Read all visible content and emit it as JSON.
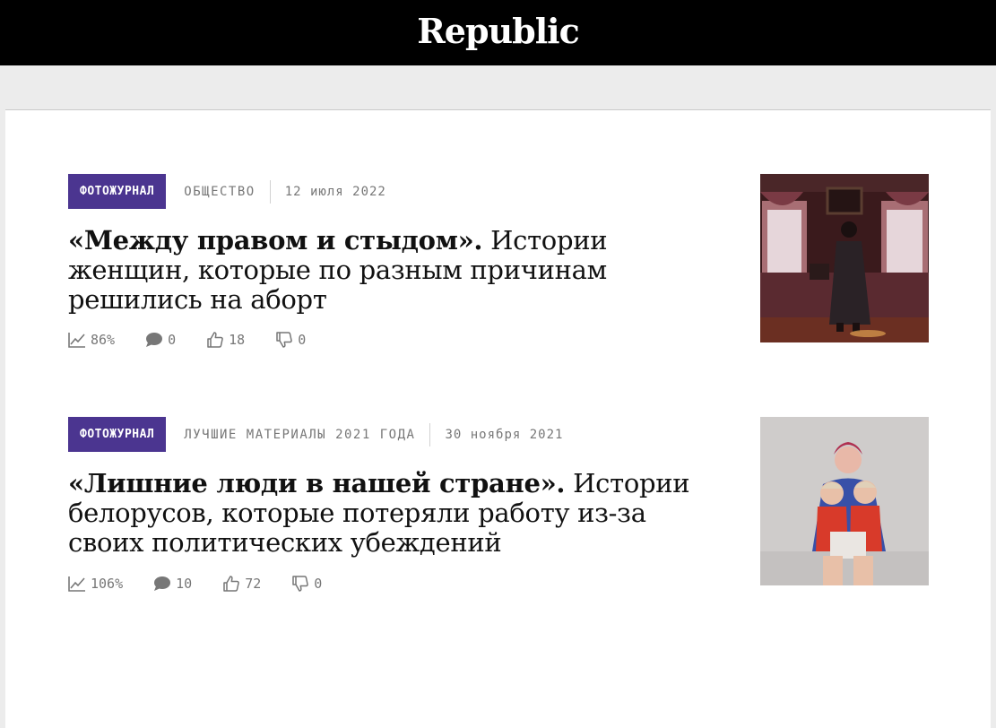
{
  "site": {
    "logo": "Republic"
  },
  "articles": [
    {
      "badge": "ФОТОЖУРНАЛ",
      "rubric": "ОБЩЕСТВО",
      "date": "12 июля 2022",
      "title_bold": "«Между правом и стыдом».",
      "title_rest": " Истории женщин, которые по разным причинам решились на аборт",
      "stats": {
        "reads": "86%",
        "comments": "0",
        "likes": "18",
        "dislikes": "0"
      },
      "image_icon": "photo-woman-at-window"
    },
    {
      "badge": "ФОТОЖУРНАЛ",
      "rubric": "ЛУЧШИЕ МАТЕРИАЛЫ 2021 ГОДА",
      "date": "30 ноября 2021",
      "title_bold": "«Лишние люди в нашей стране».",
      "title_rest": " Истории белорусов, которые потеряли работу из-за своих политических убеждений",
      "stats": {
        "reads": "106%",
        "comments": "10",
        "likes": "72",
        "dislikes": "0"
      },
      "image_icon": "photo-mother-with-children"
    }
  ],
  "colors": {
    "badge_bg": "#4b3590",
    "topbar_bg": "#000000",
    "page_bg": "#ececec"
  }
}
